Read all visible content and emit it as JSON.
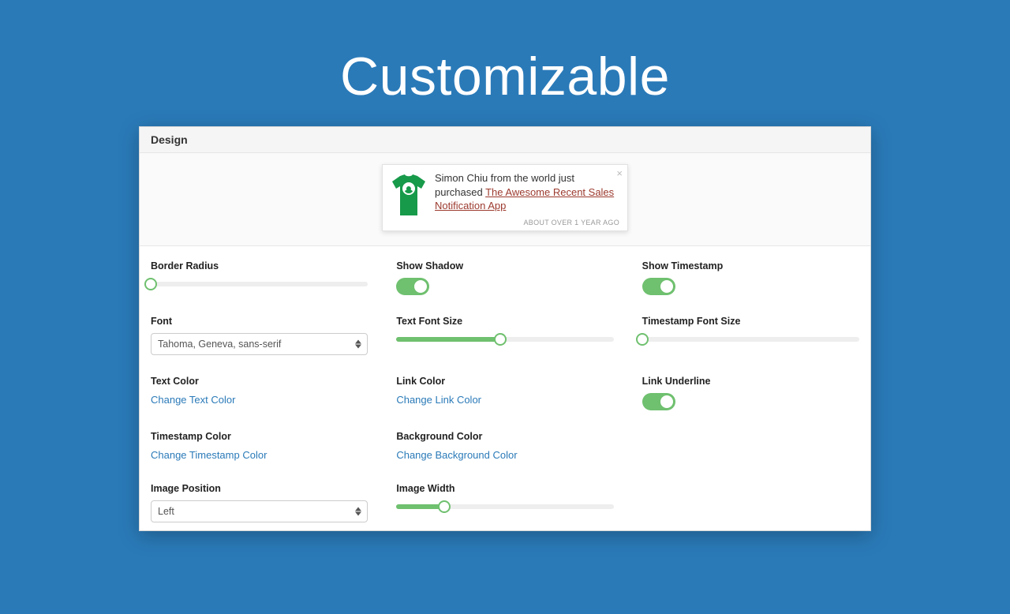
{
  "hero": {
    "title": "Customizable"
  },
  "panel": {
    "header": "Design"
  },
  "preview": {
    "text_prefix": "Simon Chiu from the world just purchased ",
    "link_text": "The Awesome Recent Sales Notification App",
    "timestamp": "ABOUT OVER 1 YEAR AGO"
  },
  "controls": {
    "border_radius": {
      "label": "Border Radius",
      "value_pct": 0
    },
    "show_shadow": {
      "label": "Show Shadow",
      "on": true
    },
    "show_timestamp": {
      "label": "Show Timestamp",
      "on": true
    },
    "font": {
      "label": "Font",
      "value": "Tahoma, Geneva, sans-serif"
    },
    "text_font_size": {
      "label": "Text Font Size",
      "value_pct": 48
    },
    "timestamp_font_size": {
      "label": "Timestamp Font Size",
      "value_pct": 0
    },
    "text_color": {
      "label": "Text Color",
      "action": "Change Text Color"
    },
    "link_color": {
      "label": "Link Color",
      "action": "Change Link Color"
    },
    "link_underline": {
      "label": "Link Underline",
      "on": true
    },
    "timestamp_color": {
      "label": "Timestamp Color",
      "action": "Change Timestamp Color"
    },
    "background_color": {
      "label": "Background Color",
      "action": "Change Background Color"
    },
    "image_position": {
      "label": "Image Position",
      "value": "Left"
    },
    "image_width": {
      "label": "Image Width",
      "value_pct": 22
    }
  }
}
